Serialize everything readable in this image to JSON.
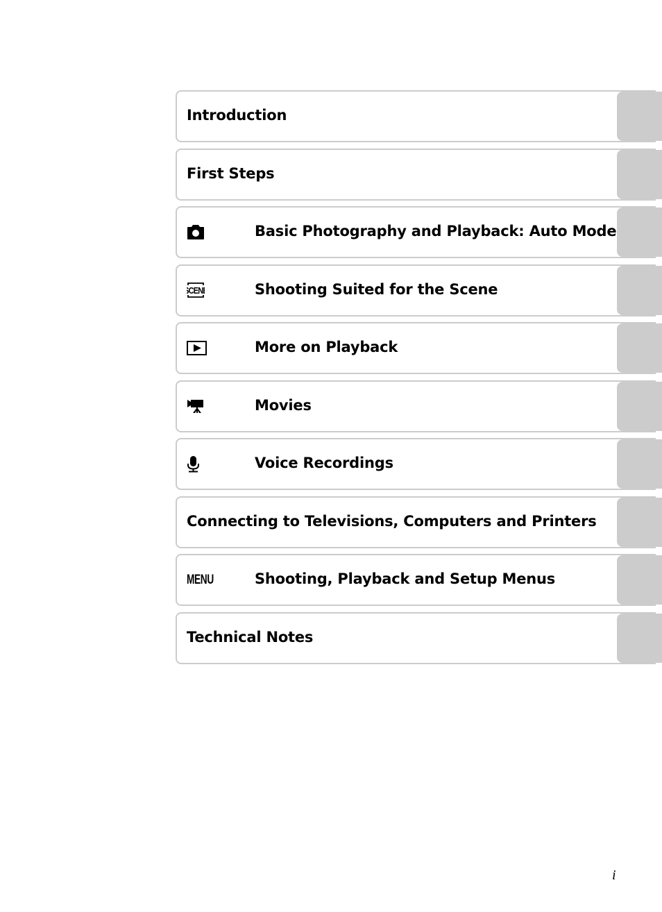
{
  "toc": {
    "items": [
      {
        "label": "Introduction",
        "icon": null
      },
      {
        "label": "First Steps",
        "icon": null
      },
      {
        "label": "Basic Photography and Playback: Auto Mode",
        "icon": "camera-icon"
      },
      {
        "label": "Shooting Suited for the Scene",
        "icon": "scene-icon"
      },
      {
        "label": "More on Playback",
        "icon": "playback-icon"
      },
      {
        "label": "Movies",
        "icon": "movie-camera-icon"
      },
      {
        "label": "Voice Recordings",
        "icon": "microphone-icon"
      },
      {
        "label": "Connecting to Televisions, Computers and Printers",
        "icon": null
      },
      {
        "label": "Shooting, Playback and Setup Menus",
        "icon": "menu-icon",
        "icon_text": "MENU"
      },
      {
        "label": "Technical Notes",
        "icon": null
      }
    ]
  },
  "footer": {
    "page_number": "i"
  },
  "colors": {
    "border": "#cccccc",
    "tab": "#cccccc",
    "text": "#000000"
  }
}
